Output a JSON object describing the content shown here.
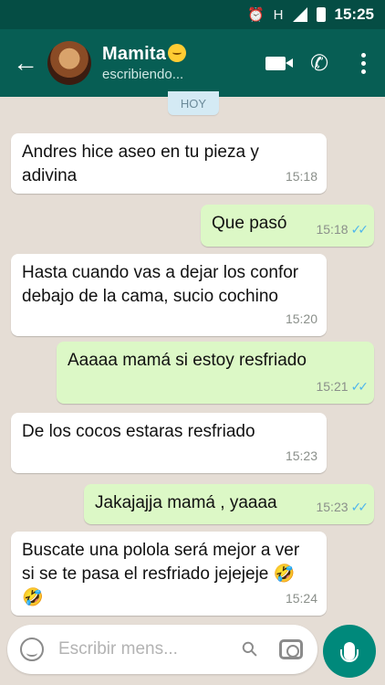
{
  "status_bar": {
    "time": "15:25",
    "network": "H"
  },
  "header": {
    "contact_name": "Mamita",
    "status": "escribiendo..."
  },
  "chat": {
    "date_chip": "HOY",
    "messages": [
      {
        "dir": "in",
        "text": "Andres hice aseo en tu pieza y adivina",
        "time": "15:18"
      },
      {
        "dir": "out",
        "text": "Que pasó",
        "time": "15:18",
        "read": true
      },
      {
        "dir": "in",
        "text": "Hasta cuando vas a dejar los confor debajo de la cama, sucio cochino",
        "time": "15:20"
      },
      {
        "dir": "out",
        "text": "Aaaaa mamá si estoy resfriado",
        "time": "15:21",
        "read": true
      },
      {
        "dir": "in",
        "text": "De los cocos estaras resfriado",
        "time": "15:23"
      },
      {
        "dir": "out",
        "text": "Jakajajja mamá , yaaaa",
        "time": "15:23",
        "read": true
      },
      {
        "dir": "in",
        "text": "Buscate una polola será mejor a ver si se te pasa el resfriado jejejeje",
        "time": "15:24",
        "emoji": "🤣🤣"
      }
    ]
  },
  "input": {
    "placeholder": "Escribir mens..."
  },
  "colors": {
    "header": "#075e54",
    "status_bar": "#054d44",
    "outgoing": "#dcf8c6",
    "incoming": "#ffffff",
    "chat_bg": "#e5ddd5",
    "mic": "#00897b",
    "read_ticks": "#4fb6ec"
  }
}
